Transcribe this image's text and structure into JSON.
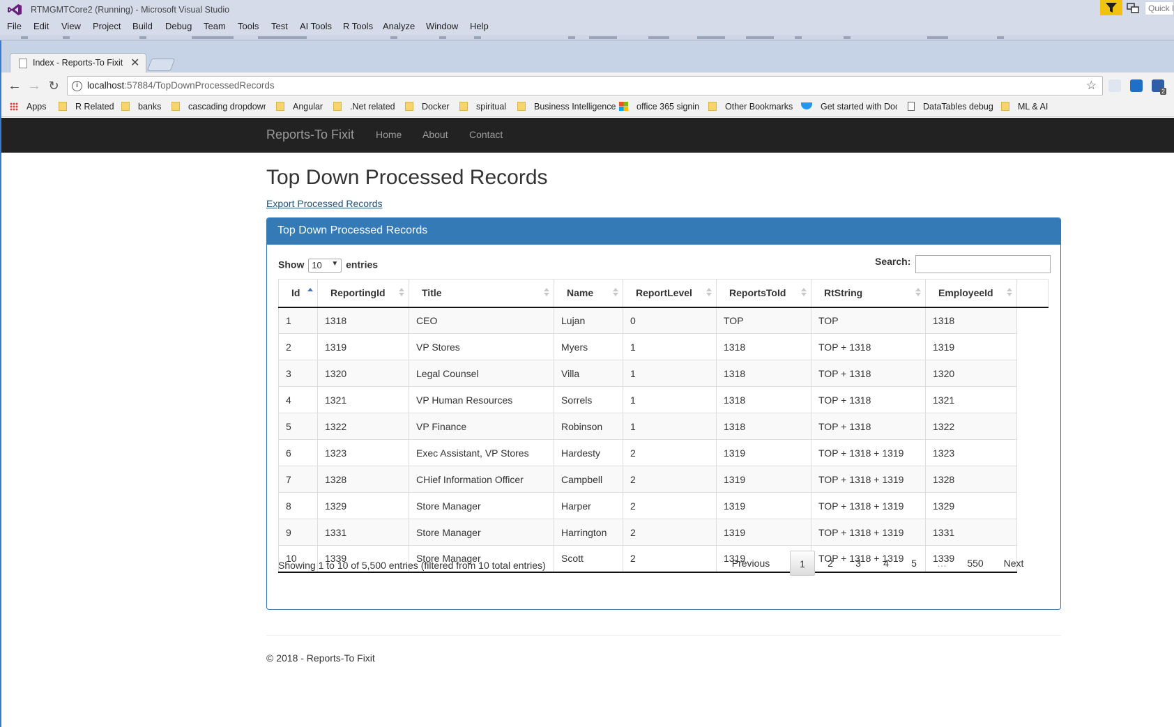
{
  "vs": {
    "title": "RTMGMTCore2 (Running) - Microsoft Visual Studio",
    "quick_launch": "Quick L",
    "menu": [
      "File",
      "Edit",
      "View",
      "Project",
      "Build",
      "Debug",
      "Team",
      "Tools",
      "Test",
      "AI Tools",
      "R Tools",
      "Analyze",
      "Window",
      "Help"
    ]
  },
  "browser": {
    "tab_title": "Index - Reports-To Fixit",
    "url_host": "localhost",
    "url_path": ":57884/TopDownProcessedRecords",
    "ext_badge": "2",
    "bookmarks": [
      "Apps",
      "R Related",
      "banks",
      "cascading dropdowr",
      "Angular",
      ".Net related",
      "Docker",
      "spiritual",
      "Business Intelligence",
      "office 365 signin",
      "Other Bookmarks",
      "Get started with Doc",
      "DataTables debug",
      "ML & AI"
    ]
  },
  "site": {
    "brand": "Reports-To Fixit",
    "nav": [
      "Home",
      "About",
      "Contact"
    ],
    "page_title": "Top Down Processed Records",
    "export_link": "Export Processed Records",
    "panel_title": "Top Down Processed Records",
    "footer": "© 2018 - Reports-To Fixit"
  },
  "datatable": {
    "show_label": "Show",
    "entries_label": "entries",
    "length_value": "10",
    "search_label": "Search:",
    "columns": [
      "Id",
      "ReportingId",
      "Title",
      "Name",
      "ReportLevel",
      "ReportsToId",
      "RtString",
      "EmployeeId",
      ""
    ],
    "rows": [
      [
        "1",
        "1318",
        "CEO",
        "Lujan",
        "0",
        "TOP",
        "TOP",
        "1318"
      ],
      [
        "2",
        "1319",
        "VP Stores",
        "Myers",
        "1",
        "1318",
        "TOP + 1318",
        "1319"
      ],
      [
        "3",
        "1320",
        "Legal Counsel",
        "Villa",
        "1",
        "1318",
        "TOP + 1318",
        "1320"
      ],
      [
        "4",
        "1321",
        "VP Human Resources",
        "Sorrels",
        "1",
        "1318",
        "TOP + 1318",
        "1321"
      ],
      [
        "5",
        "1322",
        "VP Finance",
        "Robinson",
        "1",
        "1318",
        "TOP + 1318",
        "1322"
      ],
      [
        "6",
        "1323",
        "Exec Assistant, VP Stores",
        "Hardesty",
        "2",
        "1319",
        "TOP + 1318 + 1319",
        "1323"
      ],
      [
        "7",
        "1328",
        "CHief Information Officer",
        "Campbell",
        "2",
        "1319",
        "TOP + 1318 + 1319",
        "1328"
      ],
      [
        "8",
        "1329",
        "Store Manager",
        "Harper",
        "2",
        "1319",
        "TOP + 1318 + 1319",
        "1329"
      ],
      [
        "9",
        "1331",
        "Store Manager",
        "Harrington",
        "2",
        "1319",
        "TOP + 1318 + 1319",
        "1331"
      ],
      [
        "10",
        "1339",
        "Store Manager",
        "Scott",
        "2",
        "1319",
        "TOP + 1318 + 1319",
        "1339"
      ]
    ],
    "info": "Showing 1 to 10 of 5,500 entries (filtered from 10 total entries)",
    "pagination": [
      "Previous",
      "1",
      "2",
      "3",
      "4",
      "5",
      "…",
      "550",
      "Next"
    ],
    "current_page": "1"
  },
  "colors": {
    "navbar": "#222222",
    "panel_primary": "#337ab7",
    "link": "#23527c",
    "vs_chrome": "#d6dbe9"
  }
}
